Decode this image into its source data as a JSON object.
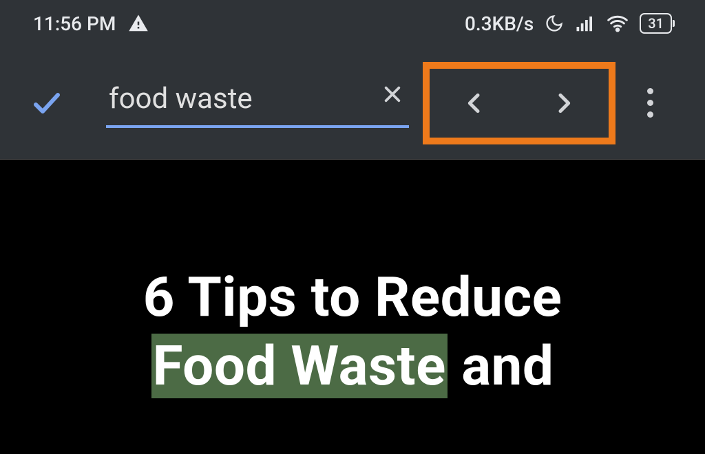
{
  "status_bar": {
    "time": "11:56 PM",
    "data_speed": "0.3KB/s",
    "battery_percent": "31"
  },
  "search": {
    "value": "food waste"
  },
  "content": {
    "title_line1_prefix": "6 Tips to Reduce",
    "title_highlight": "Food Waste",
    "title_line2_suffix": " and"
  },
  "annotation": {
    "highlight_color": "#ee7a1b",
    "search_highlight_bg": "#4c6b45"
  }
}
